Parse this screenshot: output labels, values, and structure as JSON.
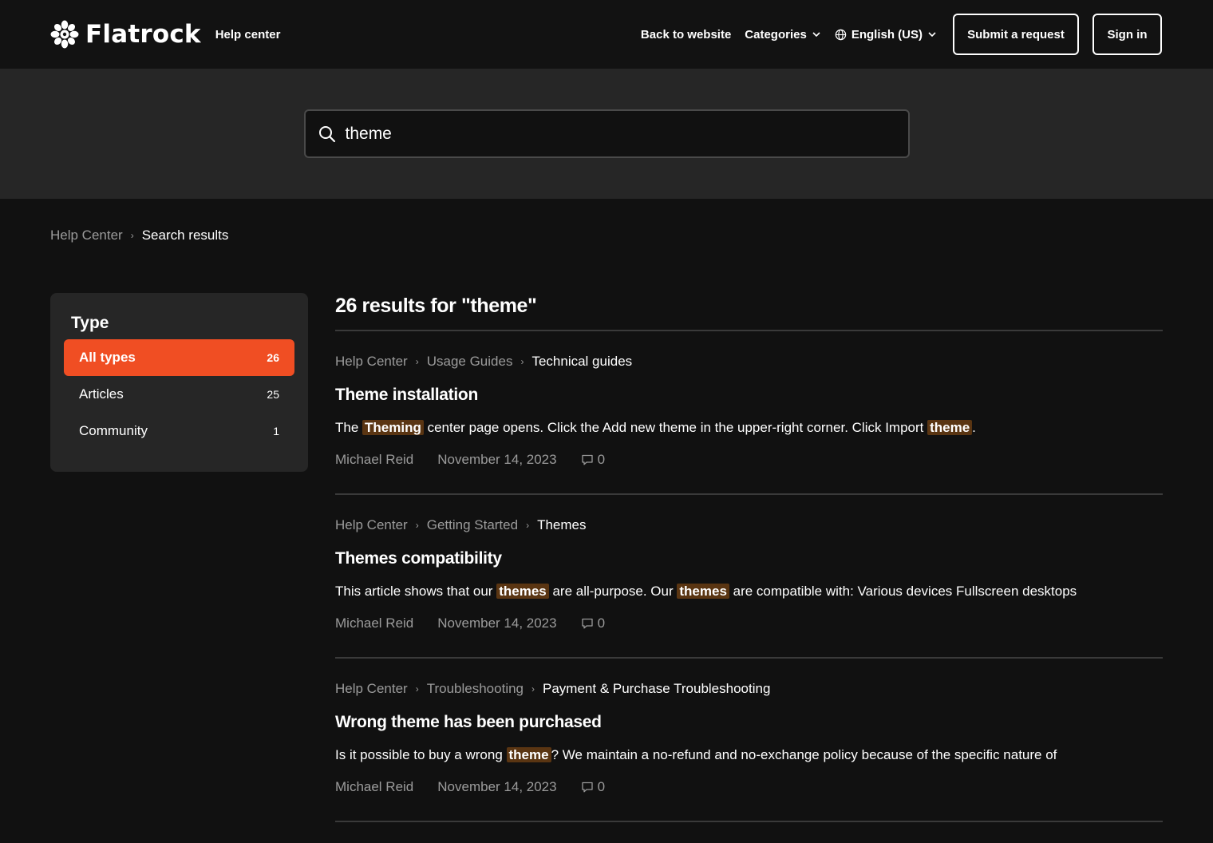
{
  "header": {
    "logo_text": "Flatrock",
    "section_label": "Help center",
    "nav": {
      "back": "Back to website",
      "categories": "Categories",
      "language": "English (US)",
      "submit": "Submit a request",
      "signin": "Sign in"
    }
  },
  "search": {
    "value": "theme"
  },
  "breadcrumb": {
    "root": "Help Center",
    "current": "Search results"
  },
  "filters": {
    "title": "Type",
    "items": [
      {
        "label": "All types",
        "count": "26"
      },
      {
        "label": "Articles",
        "count": "25"
      },
      {
        "label": "Community",
        "count": "1"
      }
    ]
  },
  "results": {
    "title": "26 results for \"theme\"",
    "items": [
      {
        "crumbs": [
          "Help Center",
          "Usage Guides",
          "Technical guides"
        ],
        "title": "Theme installation",
        "snippet": [
          {
            "t": "The "
          },
          {
            "t": "Theming",
            "hl": true
          },
          {
            "t": " center page opens. Click the Add new theme in the upper-right corner. Click Import "
          },
          {
            "t": "theme",
            "hl": true
          },
          {
            "t": "."
          }
        ],
        "author": "Michael Reid",
        "date": "November 14, 2023",
        "comments": "0"
      },
      {
        "crumbs": [
          "Help Center",
          "Getting Started",
          "Themes"
        ],
        "title": "Themes compatibility",
        "snippet": [
          {
            "t": "This article shows that our "
          },
          {
            "t": "themes",
            "hl": true
          },
          {
            "t": " are all-purpose. Our "
          },
          {
            "t": "themes",
            "hl": true
          },
          {
            "t": " are compatible with: Various devices Fullscreen desktops"
          }
        ],
        "author": "Michael Reid",
        "date": "November 14, 2023",
        "comments": "0"
      },
      {
        "crumbs": [
          "Help Center",
          "Troubleshooting",
          "Payment & Purchase Troubleshooting"
        ],
        "title": "Wrong theme has been purchased",
        "snippet": [
          {
            "t": "Is it possible to buy a wrong "
          },
          {
            "t": "theme",
            "hl": true
          },
          {
            "t": "? We maintain a no-refund and no-exchange policy because of the specific nature of"
          }
        ],
        "author": "Michael Reid",
        "date": "November 14, 2023",
        "comments": "0"
      }
    ]
  },
  "colors": {
    "accent": "#f04e23",
    "highlight": "#5a3512",
    "background": "#111111",
    "panel": "#262626"
  }
}
